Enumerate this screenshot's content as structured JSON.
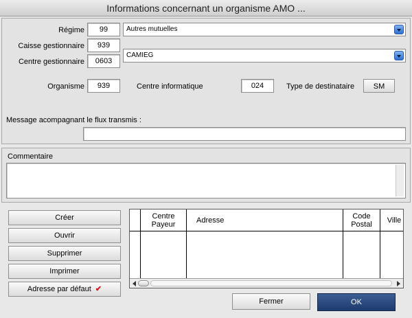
{
  "window": {
    "title": "Informations concernant un organisme AMO ..."
  },
  "regime": {
    "label": "Régime",
    "code": "99",
    "name": "Autres mutuelles"
  },
  "caisse": {
    "label": "Caisse gestionnaire",
    "code": "939",
    "name": "CAMIEG"
  },
  "centre": {
    "label": "Centre gestionnaire",
    "code": "0603"
  },
  "organisme": {
    "label": "Organisme",
    "value": "939"
  },
  "centre_info": {
    "label": "Centre informatique",
    "value": "024"
  },
  "destinataire": {
    "label": "Type de destinataire",
    "button": "SM"
  },
  "message": {
    "label": "Message acompagnant le flux transmis :",
    "value": ""
  },
  "commentaire": {
    "label": "Commentaire",
    "value": ""
  },
  "actions": {
    "creer": "Créer",
    "ouvrir": "Ouvrir",
    "supprimer": "Supprimer",
    "imprimer": "Imprimer",
    "adresse_defaut": "Adresse par défaut",
    "check": "✔"
  },
  "table": {
    "columns": [
      "Centre Payeur",
      "Adresse",
      "Code Postal",
      "Ville"
    ],
    "rows": []
  },
  "footer": {
    "fermer": "Fermer",
    "ok": "OK"
  },
  "colors": {
    "ok_button": "#2a4a80",
    "checkmark": "#d9141b",
    "popup_arrow": "#2f6fd1"
  }
}
